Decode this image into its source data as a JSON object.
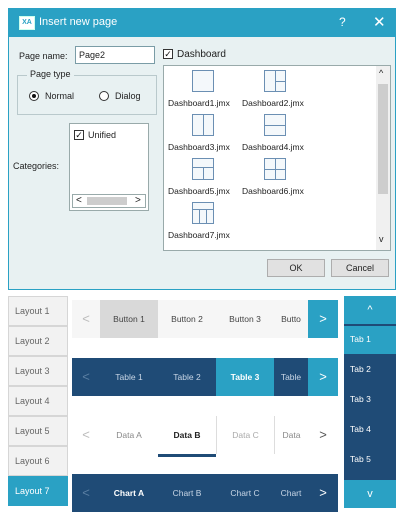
{
  "dialog": {
    "title": "Insert new page",
    "icon_text": "XA",
    "help": "?",
    "close": "✕",
    "page_name_label": "Page name:",
    "page_name_value": "Page2",
    "dashboard_label": "Dashboard",
    "page_type_label": "Page type",
    "normal_label": "Normal",
    "dialog_label": "Dialog",
    "categories_label": "Categories:",
    "unified_label": "Unified",
    "scroll_left": "<",
    "scroll_right": ">",
    "scroll_up": "^",
    "scroll_down": "v",
    "files": [
      "Dashboard1.jmx",
      "Dashboard2.jmx",
      "Dashboard3.jmx",
      "Dashboard4.jmx",
      "Dashboard5.jmx",
      "Dashboard6.jmx",
      "Dashboard7.jmx"
    ],
    "ok": "OK",
    "cancel": "Cancel"
  },
  "colors": {
    "accent": "#2aa1c4",
    "dark": "#1f4b76"
  },
  "layouts": [
    "Layout 1",
    "Layout 2",
    "Layout 3",
    "Layout 4",
    "Layout 5",
    "Layout 6",
    "Layout 7"
  ],
  "buttons_row": [
    "Button 1",
    "Button 2",
    "Button 3",
    "Butto"
  ],
  "tables_row": [
    "Table 1",
    "Table 2",
    "Table 3",
    "Table"
  ],
  "data_row": [
    "Data A",
    "Data B",
    "Data C",
    "Data"
  ],
  "charts_row": [
    "Chart A",
    "Chart B",
    "Chart C",
    "Chart"
  ],
  "arrow_left": "<",
  "arrow_right": ">",
  "right_tabs": [
    "Tab 1",
    "Tab 2",
    "Tab 3",
    "Tab 4",
    "Tab 5"
  ],
  "right_up": "^",
  "right_down": "v"
}
